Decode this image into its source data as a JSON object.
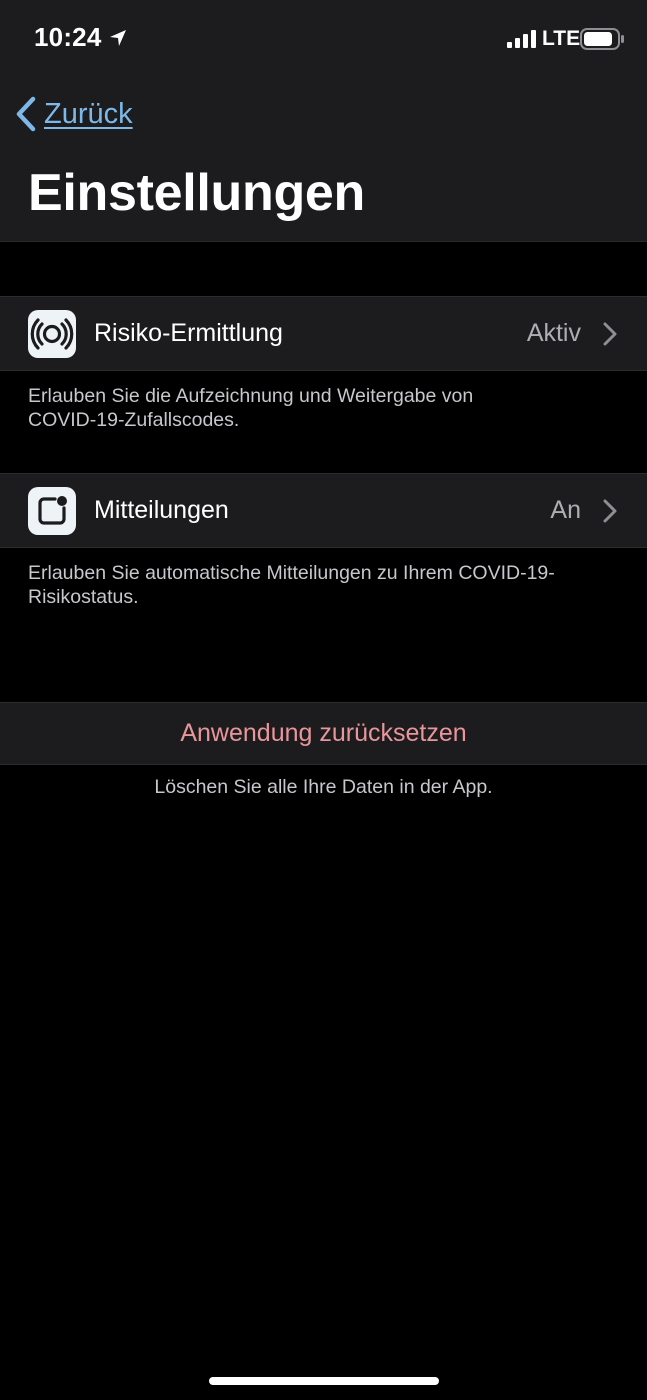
{
  "status_bar": {
    "time": "10:24",
    "network": "LTE",
    "location_icon": "location-arrow-icon",
    "signal_icon": "cellular-signal-icon",
    "battery_icon": "battery-icon"
  },
  "nav": {
    "back_label": "Zurück",
    "back_icon": "chevron-left-icon",
    "title": "Einstellungen"
  },
  "settings": [
    {
      "label": "Risiko-Ermittlung",
      "value": "Aktiv",
      "icon": "exposure-tracing-icon",
      "footer": [
        "Erlauben Sie die Aufzeichnung und Weitergabe von",
        "COVID-19-Zufallscodes."
      ]
    },
    {
      "label": "Mitteilungen",
      "value": "An",
      "icon": "notification-badge-icon",
      "footer": [
        "Erlauben Sie automatische Mitteilungen zu Ihrem COVID-19-",
        "Risikostatus."
      ]
    }
  ],
  "reset": {
    "label": "Anwendung zurücksetzen",
    "footer": "Löschen Sie alle Ihre Daten in der App."
  },
  "colors": {
    "background": "#000000",
    "surface": "#1c1c1e",
    "link": "#7db8e8",
    "destructive": "#e8969b",
    "secondary_text": "#aeaeb2"
  }
}
